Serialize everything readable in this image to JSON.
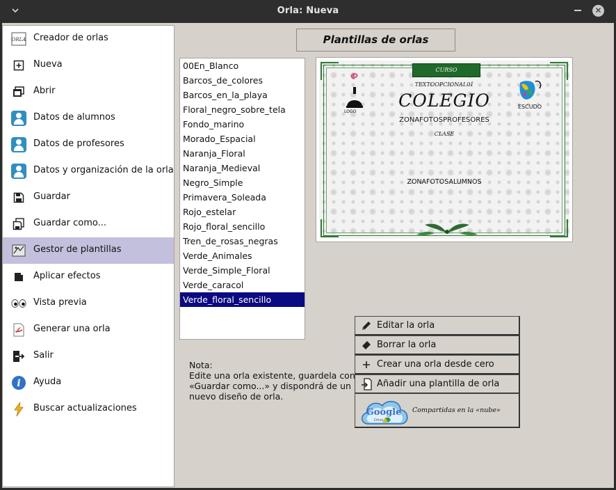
{
  "window": {
    "title": "Orla: Nueva"
  },
  "sidebar": {
    "items": [
      {
        "label": "Creador de orlas",
        "icon": "orla-logo-icon"
      },
      {
        "label": "Nueva",
        "icon": "new-icon"
      },
      {
        "label": "Abrir",
        "icon": "open-icon"
      },
      {
        "label": "Datos de alumnos",
        "icon": "person-icon"
      },
      {
        "label": "Datos de profesores",
        "icon": "person-icon"
      },
      {
        "label": "Datos y organización de la orla",
        "icon": "person-icon"
      },
      {
        "label": "Guardar",
        "icon": "save-icon"
      },
      {
        "label": "Guardar como...",
        "icon": "save-as-icon"
      },
      {
        "label": "Gestor de plantillas",
        "icon": "template-manager-icon",
        "selected": true
      },
      {
        "label": "Aplicar efectos",
        "icon": "effects-icon"
      },
      {
        "label": "Vista previa",
        "icon": "eyes-icon"
      },
      {
        "label": "Generar una orla",
        "icon": "pdf-icon"
      },
      {
        "label": "Salir",
        "icon": "exit-icon"
      },
      {
        "label": "Ayuda",
        "icon": "info-icon"
      },
      {
        "label": "Buscar actualizaciones",
        "icon": "lightning-icon"
      }
    ]
  },
  "header": {
    "title": "Plantillas de orlas"
  },
  "templates": {
    "items": [
      "00En_Blanco",
      "Barcos_de_colores",
      "Barcos_en_la_playa",
      "Floral_negro_sobre_tela",
      "Fondo_marino",
      "Morado_Espacial",
      "Naranja_Floral",
      "Naranja_Medieval",
      "Negro_Simple",
      "Primavera_Soleada",
      "Rojo_estelar",
      "Rojo_floral_sencillo",
      "Tren_de_rosas_negras",
      "Verde_Animales",
      "Verde_Simple_Floral",
      "Verde_caracol",
      "Verde_floral_sencillo"
    ],
    "selected": "Verde_floral_sencillo"
  },
  "preview": {
    "ribbon": "CURSO",
    "curso_text": "TEXTOOPCIONAL01",
    "colegio": "COLEGIO",
    "profesores": "ZONAFOTOSPROFESORES",
    "clase": "CLASE",
    "alumnos": "ZONAFOTOSALUMNOS",
    "logo": "LOGO",
    "escudo": "ESCUDO"
  },
  "actions": {
    "edit": "Editar la orla",
    "delete": "Borrar la orla",
    "create": "Crear una orla desde cero",
    "add_template": "Añadir una plantilla de orla",
    "cloud": "Compartidas en la «nube»",
    "cloud_brand": "Google",
    "cloud_sub": "Drive"
  },
  "note": {
    "title": "Nota:",
    "line1": "Edite una orla existente, guardela con",
    "line2": "«Guardar como...» y dispondrá de un",
    "line3": "nuevo diseño de orla."
  },
  "colors": {
    "selection": "#0a0a82",
    "sidebar_selected": "#c2c0dd",
    "accent_green": "#1f6a2a"
  }
}
